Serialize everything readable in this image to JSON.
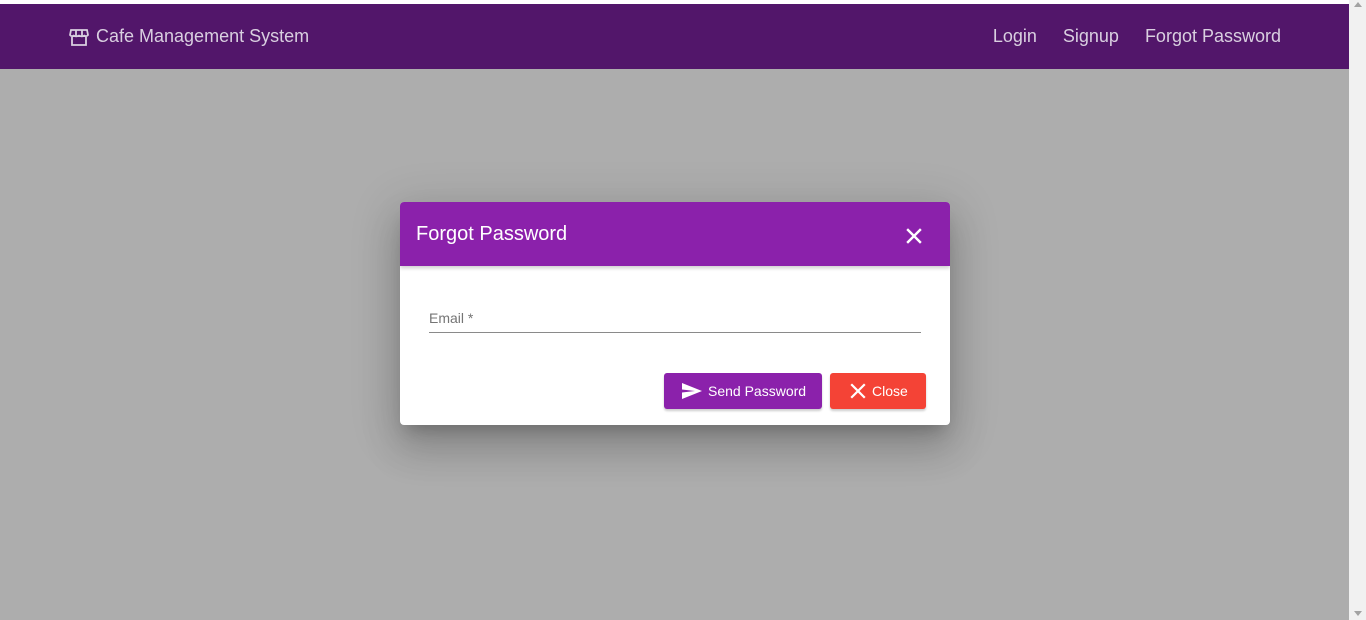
{
  "app": {
    "brand_icon": "storefront-icon",
    "title": "Cafe Management System"
  },
  "nav": {
    "links": [
      "Login",
      "Signup",
      "Forgot Password"
    ]
  },
  "dialog": {
    "title": "Forgot Password",
    "close_icon": "close-icon",
    "email": {
      "label": "Email *",
      "value": ""
    },
    "buttons": {
      "send": {
        "label": "Send Password",
        "icon": "send-icon"
      },
      "close": {
        "label": "Close",
        "icon": "close-icon"
      }
    }
  },
  "colors": {
    "navbar": "#52166a",
    "primary": "#8b21ab",
    "warn": "#f44336",
    "backdrop": "#adadad"
  }
}
